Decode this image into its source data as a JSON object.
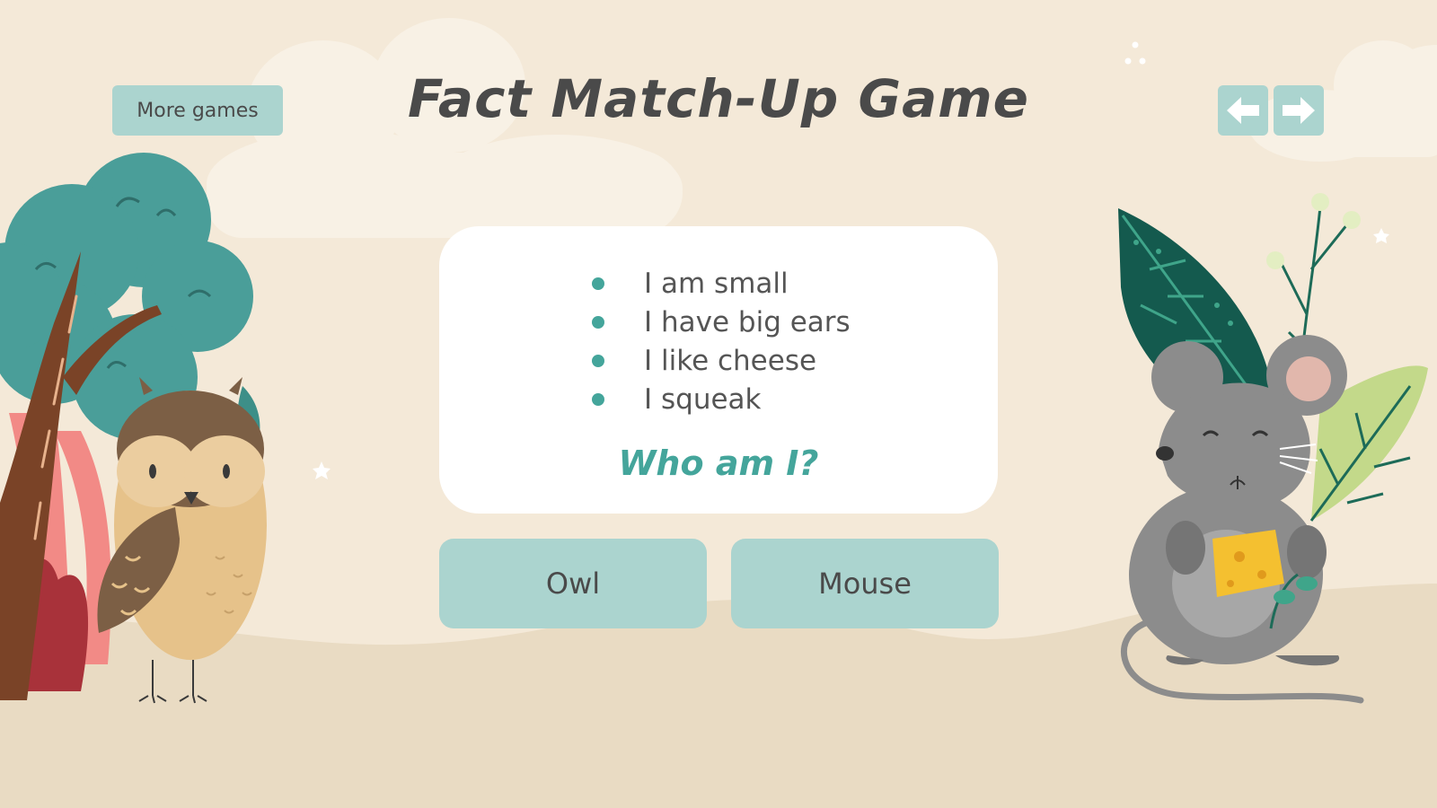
{
  "header": {
    "more_games_label": "More games",
    "title": "Fact Match-Up Game",
    "nav": {
      "prev_icon": "arrow-left-icon",
      "next_icon": "arrow-right-icon"
    }
  },
  "card": {
    "facts": [
      "I am small",
      "I have big ears",
      "I like cheese",
      "I squeak"
    ],
    "question": "Who am I?"
  },
  "answers": [
    "Owl",
    "Mouse"
  ],
  "colors": {
    "background": "#f4e9d8",
    "ground": "#e9dbc3",
    "button": "#abd4cf",
    "accent": "#44a59b",
    "text": "#4a4a4a"
  }
}
